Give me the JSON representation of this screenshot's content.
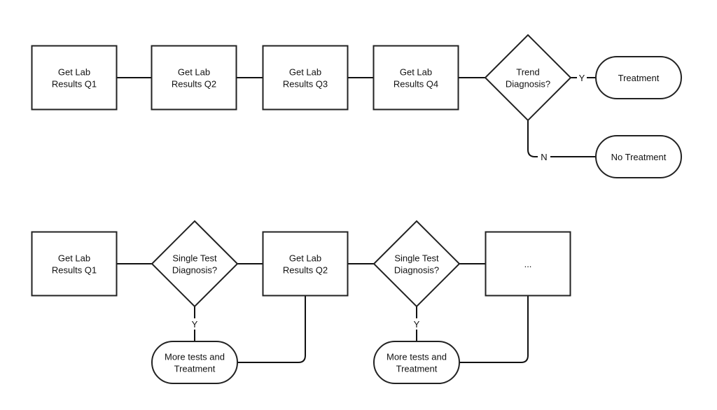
{
  "diagram": {
    "top_row": {
      "nodes": [
        {
          "id": "t1",
          "type": "process",
          "lines": [
            "Get Lab",
            "Results Q1"
          ]
        },
        {
          "id": "t2",
          "type": "process",
          "lines": [
            "Get Lab",
            "Results Q2"
          ]
        },
        {
          "id": "t3",
          "type": "process",
          "lines": [
            "Get Lab",
            "Results Q3"
          ]
        },
        {
          "id": "t4",
          "type": "process",
          "lines": [
            "Get Lab",
            "Results Q4"
          ]
        },
        {
          "id": "td",
          "type": "decision",
          "lines": [
            "Trend",
            "Diagnosis?"
          ]
        },
        {
          "id": "tyes",
          "type": "terminal",
          "lines": [
            "Treatment"
          ]
        },
        {
          "id": "tno",
          "type": "terminal",
          "lines": [
            "No Treatment"
          ]
        }
      ],
      "edges": [
        {
          "from": "t1",
          "to": "t2",
          "label": ""
        },
        {
          "from": "t2",
          "to": "t3",
          "label": ""
        },
        {
          "from": "t3",
          "to": "t4",
          "label": ""
        },
        {
          "from": "t4",
          "to": "td",
          "label": ""
        },
        {
          "from": "td",
          "to": "tyes",
          "label": "Y"
        },
        {
          "from": "td",
          "to": "tno",
          "label": "N"
        }
      ]
    },
    "bottom_row": {
      "nodes": [
        {
          "id": "b1",
          "type": "process",
          "lines": [
            "Get Lab",
            "Results Q1"
          ]
        },
        {
          "id": "bd1",
          "type": "decision",
          "lines": [
            "Single Test",
            "Diagnosis?"
          ]
        },
        {
          "id": "b2",
          "type": "process",
          "lines": [
            "Get Lab",
            "Results Q2"
          ]
        },
        {
          "id": "bd2",
          "type": "decision",
          "lines": [
            "Single Test",
            "Diagnosis?"
          ]
        },
        {
          "id": "b3",
          "type": "process",
          "lines": [
            "..."
          ]
        },
        {
          "id": "bt1",
          "type": "terminal",
          "lines": [
            "More tests and",
            "Treatment"
          ]
        },
        {
          "id": "bt2",
          "type": "terminal",
          "lines": [
            "More tests and",
            "Treatment"
          ]
        }
      ],
      "edges": [
        {
          "from": "b1",
          "to": "bd1",
          "label": ""
        },
        {
          "from": "bd1",
          "to": "b2",
          "label": ""
        },
        {
          "from": "b2",
          "to": "bd2",
          "label": ""
        },
        {
          "from": "bd2",
          "to": "b3",
          "label": ""
        },
        {
          "from": "bd1",
          "to": "bt1",
          "label": "Y"
        },
        {
          "from": "bt1",
          "to": "b2",
          "label": ""
        },
        {
          "from": "bd2",
          "to": "bt2",
          "label": "Y"
        },
        {
          "from": "bt2",
          "to": "b3",
          "label": ""
        }
      ]
    }
  }
}
